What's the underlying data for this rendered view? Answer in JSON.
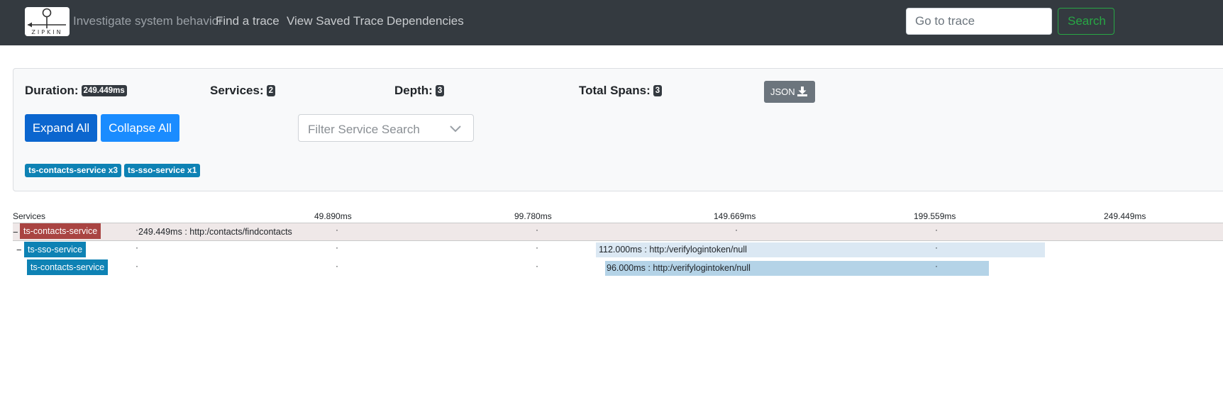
{
  "navbar": {
    "logo_text": "ZIPKIN",
    "tagline": "Investigate system behavior",
    "links": [
      "Find a trace",
      "View Saved Trace",
      "Dependencies"
    ],
    "goto_placeholder": "Go to trace",
    "search_label": "Search"
  },
  "summary": {
    "duration_label": "Duration:",
    "duration_value": "249.449ms",
    "services_label": "Services:",
    "services_value": "2",
    "depth_label": "Depth:",
    "depth_value": "3",
    "spans_label": "Total Spans:",
    "spans_value": "3",
    "json_label": "JSON",
    "expand_label": "Expand All",
    "collapse_label": "Collapse All",
    "filter_placeholder": "Filter Service Search",
    "service_badges": [
      "ts-contacts-service x3",
      "ts-sso-service x1"
    ]
  },
  "timeline": {
    "header_label": "Services",
    "ticks": [
      "49.890ms",
      "99.780ms",
      "149.669ms",
      "199.559ms",
      "249.449ms"
    ],
    "rows": [
      {
        "toggle": "−",
        "service": "ts-contacts-service",
        "span_text": "249.449ms : http:/contacts/findcontacts",
        "color": "#a94442"
      },
      {
        "toggle": "−",
        "service": "ts-sso-service",
        "span_text": "112.000ms : http:/verifylogintoken/null",
        "color": "#0e82b4"
      },
      {
        "toggle": "",
        "service": "ts-contacts-service",
        "span_text": "96.000ms : http:/verifylogintoken/null",
        "color": "#0e82b4"
      }
    ]
  },
  "colors": {
    "navbar_bg": "#343a40",
    "primary": "#0b66cf",
    "success": "#28a745",
    "service_contacts_root": "#a94442",
    "service_blue": "#0e82b4",
    "span_light": "#dbe8f3",
    "span_medium": "#b4d3e7"
  }
}
